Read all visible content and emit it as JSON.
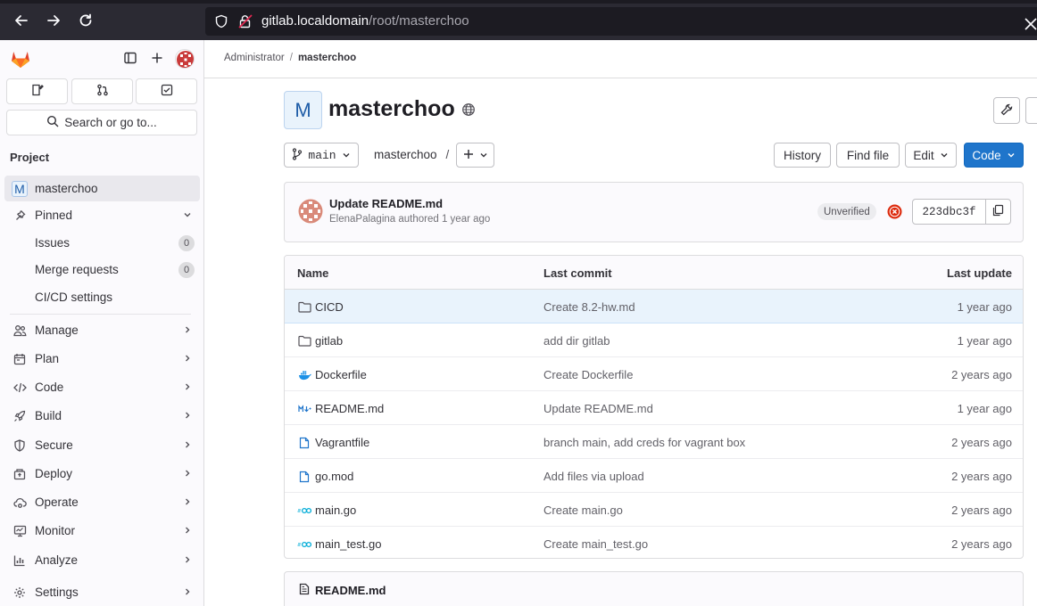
{
  "browser": {
    "url_host": "gitlab.localdomain",
    "url_path": "/root/masterchoo"
  },
  "sidebar": {
    "search_label": "Search or go to...",
    "section_title": "Project",
    "project_initial": "M",
    "project_name": "masterchoo",
    "pinned_label": "Pinned",
    "pinned_items": [
      {
        "label": "Issues",
        "count": "0"
      },
      {
        "label": "Merge requests",
        "count": "0"
      },
      {
        "label": "CI/CD settings",
        "count": ""
      }
    ],
    "nav_items": [
      {
        "label": "Manage",
        "icon": "users-icon"
      },
      {
        "label": "Plan",
        "icon": "planning-icon"
      },
      {
        "label": "Code",
        "icon": "code-icon"
      },
      {
        "label": "Build",
        "icon": "rocket-icon"
      },
      {
        "label": "Secure",
        "icon": "shield-icon"
      },
      {
        "label": "Deploy",
        "icon": "deployments-icon"
      },
      {
        "label": "Operate",
        "icon": "cloud-gear-icon"
      },
      {
        "label": "Monitor",
        "icon": "monitor-icon"
      },
      {
        "label": "Analyze",
        "icon": "chart-icon"
      },
      {
        "label": "Settings",
        "icon": "settings-icon"
      }
    ]
  },
  "breadcrumb": {
    "parent": "Administrator",
    "separator": "/",
    "current": "masterchoo"
  },
  "project": {
    "initial": "M",
    "title": "masterchoo"
  },
  "repo_toolbar": {
    "branch": "main",
    "path_root": "masterchoo",
    "path_sep": "/",
    "history_label": "History",
    "find_file_label": "Find file",
    "edit_label": "Edit",
    "code_label": "Code"
  },
  "last_commit": {
    "title": "Update README.md",
    "author": "ElenaPalagina",
    "meta_suffix": "authored 1 year ago",
    "signature": "Unverified",
    "pipeline_status": "failed",
    "sha": "223dbc3f"
  },
  "file_table": {
    "headers": {
      "name": "Name",
      "last_commit": "Last commit",
      "last_update": "Last update"
    },
    "rows": [
      {
        "name": "CICD",
        "type": "folder",
        "commit": "Create 8.2-hw.md",
        "updated": "1 year ago"
      },
      {
        "name": "gitlab",
        "type": "folder",
        "commit": "add dir gitlab",
        "updated": "1 year ago"
      },
      {
        "name": "Dockerfile",
        "type": "docker",
        "commit": "Create Dockerfile",
        "updated": "2 years ago"
      },
      {
        "name": "README.md",
        "type": "markdown",
        "commit": "Update README.md",
        "updated": "1 year ago"
      },
      {
        "name": "Vagrantfile",
        "type": "file",
        "commit": "branch main, add creds for vagrant box",
        "updated": "2 years ago"
      },
      {
        "name": "go.mod",
        "type": "file",
        "commit": "Add files via upload",
        "updated": "2 years ago"
      },
      {
        "name": "main.go",
        "type": "go",
        "commit": "Create main.go",
        "updated": "2 years ago"
      },
      {
        "name": "main_test.go",
        "type": "go",
        "commit": "Create main_test.go",
        "updated": "2 years ago"
      }
    ]
  },
  "readme": {
    "title": "README.md"
  },
  "colors": {
    "accent": "#1f75cb",
    "browser_bg": "#2b2a33",
    "status_failed": "#dd2b0e"
  }
}
